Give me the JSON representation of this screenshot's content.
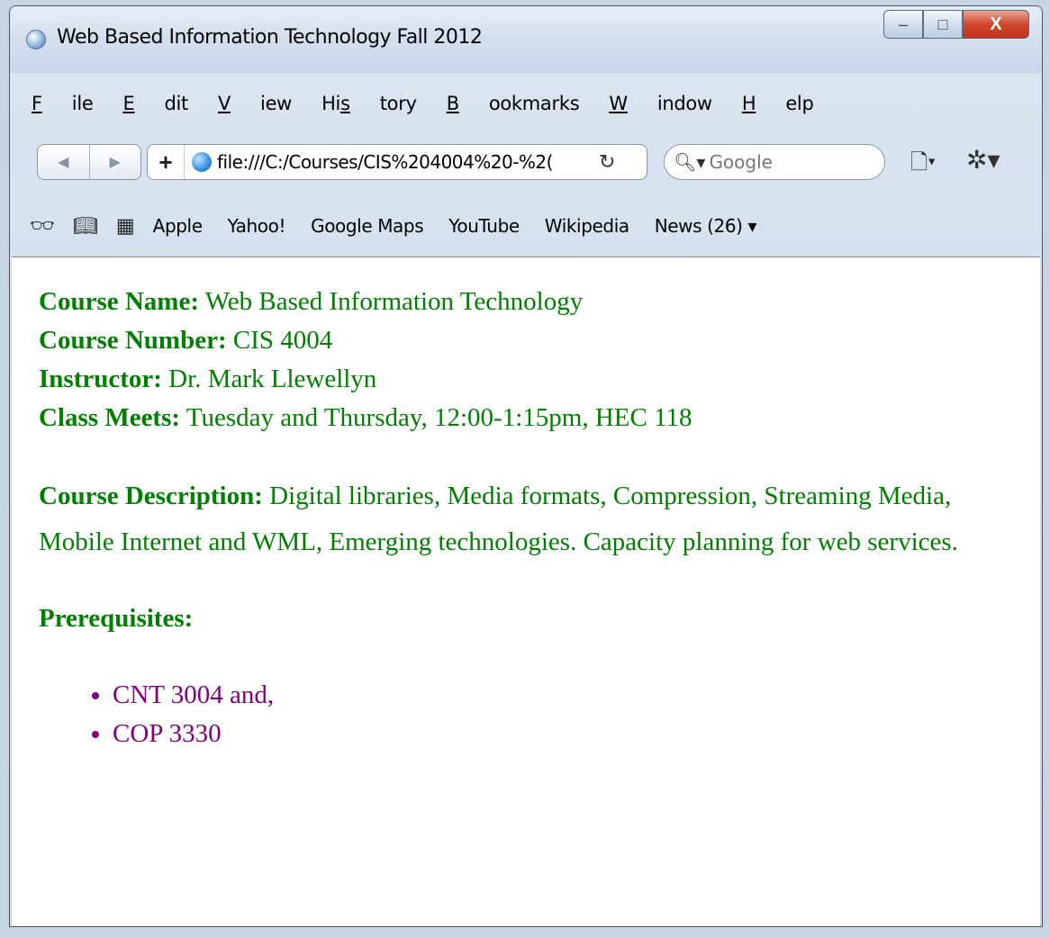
{
  "window": {
    "title": "Web Based Information Technology Fall 2012",
    "controls": {
      "minimize": "–",
      "maximize": "□",
      "close": "X"
    }
  },
  "menu": {
    "items": [
      {
        "label": "File",
        "accel": "F"
      },
      {
        "label": "Edit",
        "accel": "E"
      },
      {
        "label": "View",
        "accel": "V"
      },
      {
        "label": "History",
        "accel": "s"
      },
      {
        "label": "Bookmarks",
        "accel": "B"
      },
      {
        "label": "Window",
        "accel": "W"
      },
      {
        "label": "Help",
        "accel": "H"
      }
    ]
  },
  "toolbar": {
    "back": "◀",
    "forward": "▶",
    "add": "+",
    "url": "file:///C:/Courses/CIS%204004%20-%2(",
    "reload": "↻",
    "search_placeholder": "Google",
    "page_menu": "🗋▾",
    "gear_menu": "✲▾"
  },
  "bookmarks": {
    "icons": [
      "reading-glasses-icon",
      "open-book-icon",
      "grid-icon"
    ],
    "items": [
      "Apple",
      "Yahoo!",
      "Google Maps",
      "YouTube",
      "Wikipedia",
      "News (26) ▾"
    ]
  },
  "page": {
    "course_name_label": "Course Name:",
    "course_name": " Web Based Information Technology",
    "course_number_label": "Course Number:",
    "course_number": " CIS 4004",
    "instructor_label": "Instructor:",
    "instructor": " Dr. Mark Llewellyn",
    "class_meets_label": "Class Meets:",
    "class_meets": " Tuesday and Thursday, 12:00-1:15pm, HEC 118",
    "description_label": "Course Description:",
    "description": " Digital libraries, Media formats, Compression, Streaming Media, Mobile Internet and WML, Emerging technologies. Capacity planning for web services.",
    "prerequisites_label": "Prerequisites:",
    "prerequisites": [
      "CNT 3004 and,",
      "COP 3330"
    ]
  },
  "colors": {
    "content_text": "#008000",
    "list_text": "#800080"
  }
}
